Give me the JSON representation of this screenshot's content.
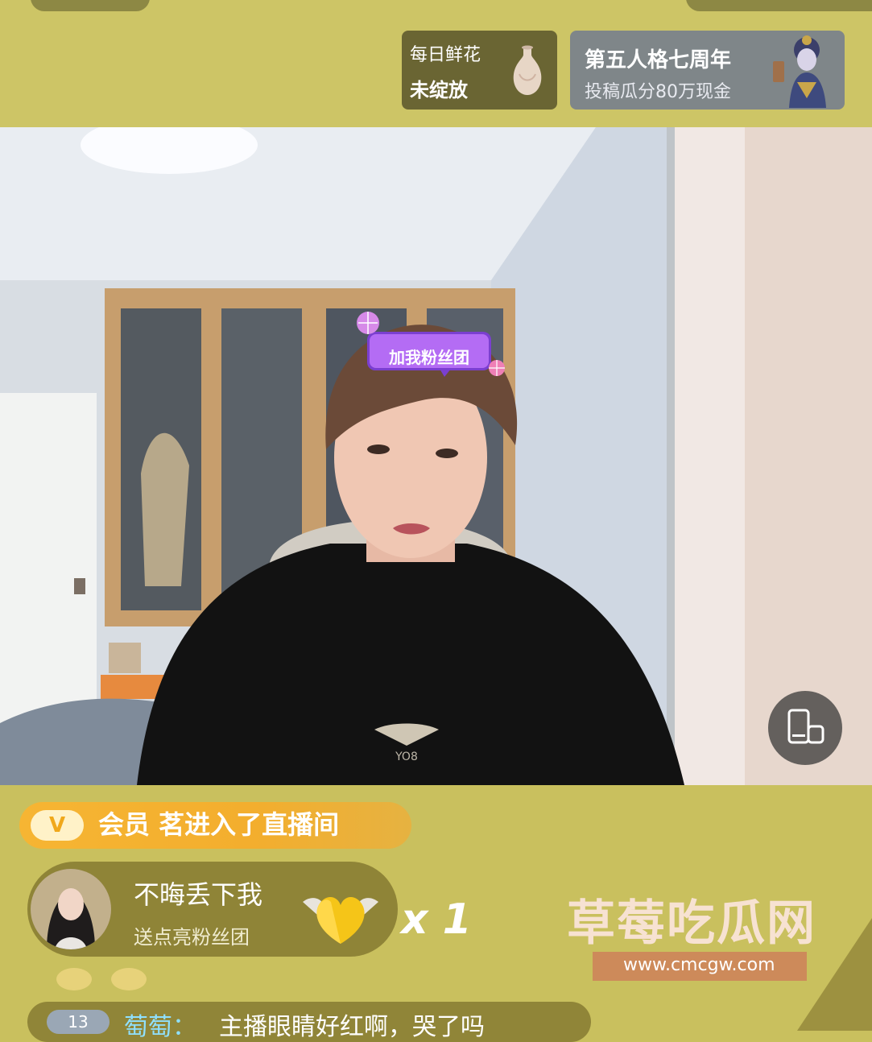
{
  "top": {
    "flower": {
      "line1": "每日鲜花",
      "line2": "未绽放"
    },
    "event": {
      "title": "第五人格七周年",
      "subtitle": "投稿瓜分80万现金"
    }
  },
  "video": {
    "overlay_tag": "加我粉丝团",
    "rotate_icon": "rotate-screen-icon"
  },
  "feed": {
    "enter_badge": "V",
    "enter_text": "会员 茗进入了直播间",
    "gift": {
      "user": "不晦丢下我",
      "action": "送点亮粉丝团",
      "icon": "heart-icon",
      "count": "x 1"
    },
    "chat": {
      "level": "13",
      "user": "萄萄：",
      "text": "主播眼睛好红啊，哭了吗"
    }
  },
  "watermark": {
    "title": "草莓吃瓜网",
    "url": "www.cmcgw.com"
  },
  "colors": {
    "background": "#c9c05e",
    "enter_banner": "#f3ae2e",
    "chat_user": "#8fe0ff"
  }
}
